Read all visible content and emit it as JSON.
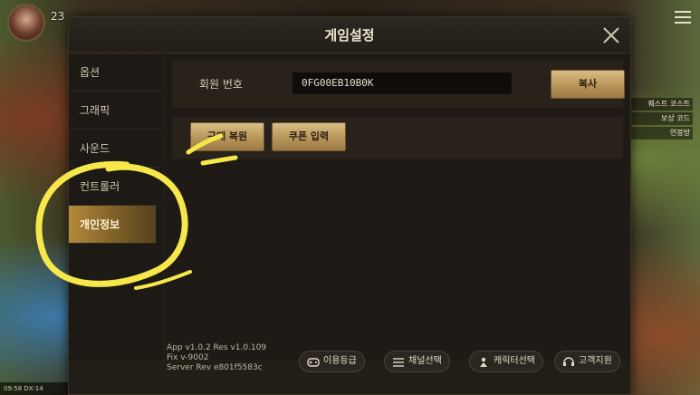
{
  "background": {
    "level": "23",
    "right_labels": [
      "퀘스트 코스트",
      "보상 코드",
      "연봉방"
    ],
    "bottom_left": "09:58  DX-14"
  },
  "dialog": {
    "title": "게임설정"
  },
  "sidebar": {
    "items": [
      {
        "label": "옵션"
      },
      {
        "label": "그래픽"
      },
      {
        "label": "사운드"
      },
      {
        "label": "컨트롤러"
      },
      {
        "label": "개인정보"
      }
    ],
    "active_index": 4
  },
  "member": {
    "label": "회원 번호",
    "value": "0FG00EB10B0K",
    "copy_label": "복사"
  },
  "actions": {
    "restore_label": "구매 복원",
    "coupon_label": "쿠폰 입력"
  },
  "footer": {
    "version_line1": "App v1.0.2 Res v1.0.109",
    "version_line2": "Fix v-9002",
    "version_line3": "Server Rev e801f5583c",
    "buttons": [
      {
        "label": "이용등급",
        "icon": "gamepad-icon"
      },
      {
        "label": "채널선택",
        "icon": "list-icon"
      },
      {
        "label": "캐릭터선택",
        "icon": "character-icon"
      },
      {
        "label": "고객지원",
        "icon": "support-icon"
      }
    ]
  },
  "colors": {
    "accent_gold": "#b48a3a",
    "scribble_yellow": "#f6e84a"
  }
}
